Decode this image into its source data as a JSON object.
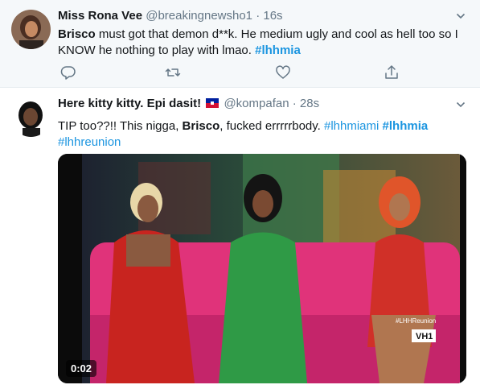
{
  "tweets": [
    {
      "name": "Miss Rona Vee",
      "handle": "@breakingnewsho1",
      "sep": "·",
      "time": "16s",
      "text_parts": {
        "p1": "Brisco",
        "p2": " must got that demon d**k. He medium ugly and cool as hell too so I KNOW he nothing to play with lmao.  ",
        "p3": "#lhhmia"
      }
    },
    {
      "name": "Here kitty kitty. Epi dasit!",
      "handle": "@kompafan",
      "sep": "·",
      "time": "28s",
      "text_parts": {
        "p1": "TIP too??!! This nigga, ",
        "p2": "Brisco",
        "p3": ", fucked errrrrbody. ",
        "p4": "#lhhmiami",
        "p5": " ",
        "p6": "#lhhmia",
        "p7": "#lhhreunion"
      },
      "video": {
        "duration": "0:02",
        "watermark_top": "#LHHReunion",
        "watermark_logo": "VH1"
      }
    }
  ],
  "icons": {
    "reply": "reply-icon",
    "retweet": "retweet-icon",
    "like": "like-icon",
    "share": "share-icon",
    "caret": "chevron-down-icon",
    "flag": "haiti-flag-icon"
  },
  "colors": {
    "link": "#1b95e0",
    "muted": "#657786",
    "bg_hover": "#f5f8fa",
    "accent": "#1da1f2"
  }
}
